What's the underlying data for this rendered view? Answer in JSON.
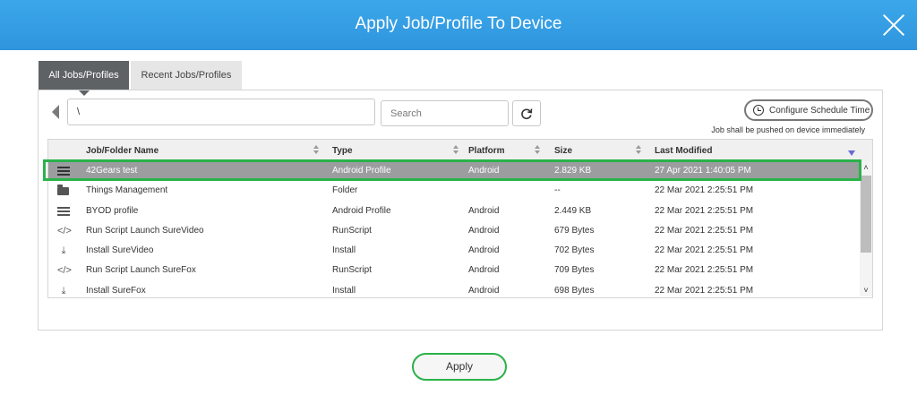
{
  "dialog": {
    "title": "Apply Job/Profile To Device",
    "apply_label": "Apply"
  },
  "tabs": [
    {
      "label": "All Jobs/Profiles",
      "active": true
    },
    {
      "label": "Recent Jobs/Profiles",
      "active": false
    }
  ],
  "toolbar": {
    "path_value": "\\",
    "search_placeholder": "Search",
    "schedule_button_label": "Configure Schedule Time",
    "schedule_note": "Job shall be pushed on device immediately"
  },
  "table": {
    "columns": [
      "Job/Folder Name",
      "Type",
      "Platform",
      "Size",
      "Last Modified"
    ],
    "rows": [
      {
        "icon": "profile-icon",
        "name": "42Gears test",
        "type": "Android Profile",
        "platform": "Android",
        "size": "2.829 KB",
        "modified": "27 Apr 2021 1:40:05 PM",
        "selected": true
      },
      {
        "icon": "folder-icon",
        "name": "Things Management",
        "type": "Folder",
        "platform": "",
        "size": "--",
        "modified": "22 Mar 2021 2:25:51 PM",
        "selected": false
      },
      {
        "icon": "profile-icon",
        "name": "BYOD profile",
        "type": "Android Profile",
        "platform": "Android",
        "size": "2.449 KB",
        "modified": "22 Mar 2021 2:25:51 PM",
        "selected": false
      },
      {
        "icon": "code-icon",
        "name": "Run Script Launch SureVideo",
        "type": "RunScript",
        "platform": "Android",
        "size": "679 Bytes",
        "modified": "22 Mar 2021 2:25:51 PM",
        "selected": false
      },
      {
        "icon": "download-icon",
        "name": "Install SureVideo",
        "type": "Install",
        "platform": "Android",
        "size": "702 Bytes",
        "modified": "22 Mar 2021 2:25:51 PM",
        "selected": false
      },
      {
        "icon": "code-icon",
        "name": "Run Script Launch SureFox",
        "type": "RunScript",
        "platform": "Android",
        "size": "709 Bytes",
        "modified": "22 Mar 2021 2:25:51 PM",
        "selected": false
      },
      {
        "icon": "download-icon",
        "name": "Install SureFox",
        "type": "Install",
        "platform": "Android",
        "size": "698 Bytes",
        "modified": "22 Mar 2021 2:25:51 PM",
        "selected": false
      }
    ]
  },
  "colors": {
    "header": "#3ba7ea",
    "selected_row": "#9b9d9f",
    "highlight": "#2ab24a"
  }
}
